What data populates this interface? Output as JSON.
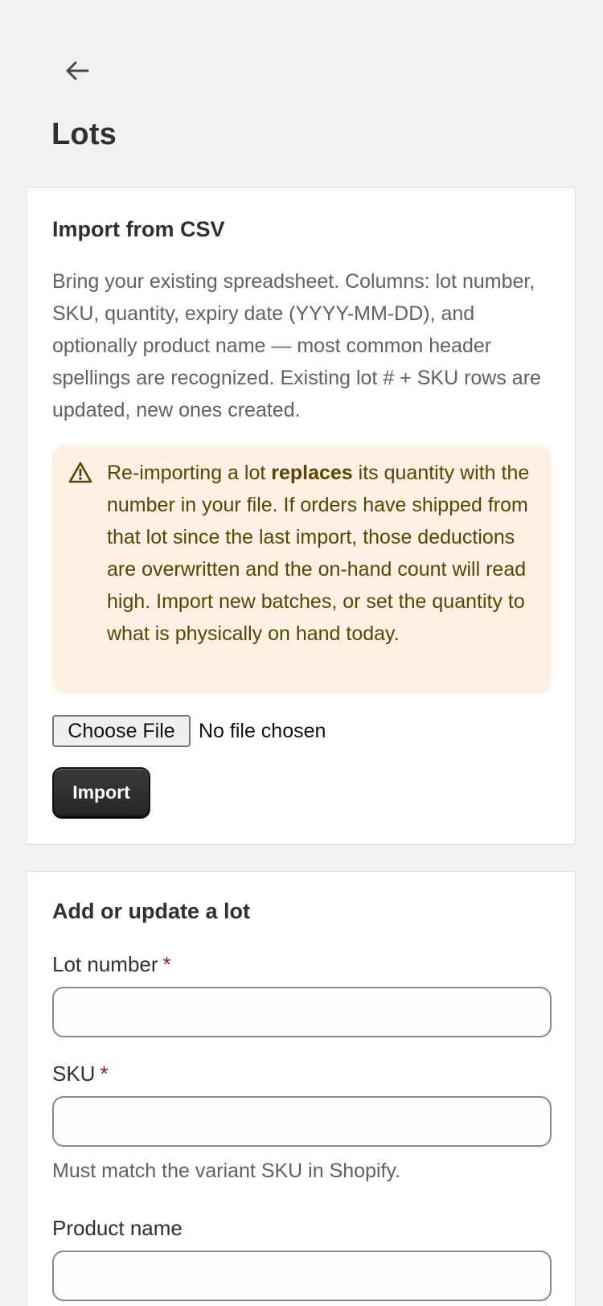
{
  "page": {
    "title": "Lots"
  },
  "import_card": {
    "heading": "Import from CSV",
    "description": "Bring your existing spreadsheet. Columns: lot number, SKU, quantity, expiry date (YYYY-MM-DD), and optionally product name — most common header spellings are recognized. Existing lot # + SKU rows are updated, new ones created.",
    "warning": {
      "text_before": "Re-importing a lot ",
      "text_bold": "replaces",
      "text_after": " its quantity with the number in your file. If orders have shipped from that lot since the last import, those deductions are overwritten and the on-hand count will read high. Import new batches, or set the quantity to what is physically on hand today."
    },
    "choose_file_label": "Choose File",
    "file_status": "No file chosen",
    "import_label": "Import"
  },
  "add_card": {
    "heading": "Add or update a lot",
    "lot_number_label": "Lot number",
    "lot_number_value": "",
    "sku_label": "SKU",
    "sku_value": "",
    "sku_help": "Must match the variant SKU in Shopify.",
    "product_name_label": "Product name",
    "product_name_value": "",
    "required_mark": "*"
  },
  "icons": {
    "back": "arrow-left-icon",
    "warning": "alert-triangle-icon"
  },
  "colors": {
    "background": "#f1f1f1",
    "card": "#ffffff",
    "warning_bg": "#fff1e3",
    "warning_text": "#5e4200",
    "required": "#8e1f0b",
    "primary_button": "#303030"
  }
}
